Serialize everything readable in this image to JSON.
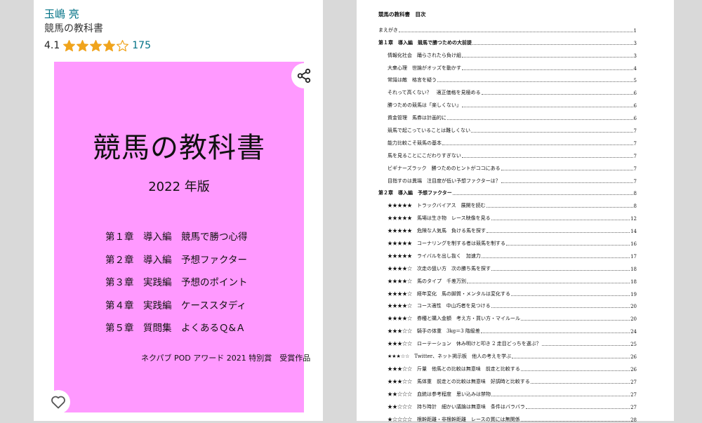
{
  "book": {
    "author": "玉嶋 亮",
    "title": "競馬の教科書",
    "rating": "4.1",
    "rating_stars": 4.1,
    "rating_count": "175"
  },
  "cover": {
    "title": "競馬の教科書",
    "edition": "2022 年版",
    "chapters": [
      "第１章　導入編　競馬で勝つ心得",
      "第２章　導入編　予想ファクター",
      "第３章　実践編　予想のポイント",
      "第４章　実践編　ケーススタディ",
      "第５章　質問集　よくあるＱ&Ａ"
    ],
    "award": "ネクパブ POD アワード 2021 特別賞　受賞作品",
    "background_color": "#ff99ff"
  },
  "icons": {
    "share": "share-icon",
    "favorite": "heart-icon",
    "star": "star-icon"
  },
  "colors": {
    "link": "#007185",
    "star": "#f0a41c"
  },
  "toc": {
    "heading": "競馬の教科書　目次",
    "entries": [
      {
        "text": "まえがき",
        "page": "1",
        "level": 0,
        "bold": false
      },
      {
        "text": "第１章　導入編　競馬で勝つための大前提",
        "page": "3",
        "level": 0,
        "bold": true
      },
      {
        "text": "情報化社会　踊らされたら負け組",
        "page": "3",
        "level": 1,
        "bold": false
      },
      {
        "text": "大衆心理　世論がオッズを動かす",
        "page": "4",
        "level": 1,
        "bold": false
      },
      {
        "text": "常識は敵　格言を疑う",
        "page": "5",
        "level": 1,
        "bold": false
      },
      {
        "text": "それって高くない？　適正価格を見極める",
        "page": "6",
        "level": 1,
        "bold": false
      },
      {
        "text": "勝つための競馬は「楽しくない」",
        "page": "6",
        "level": 1,
        "bold": false
      },
      {
        "text": "資金管理　馬券は計画的に",
        "page": "6",
        "level": 1,
        "bold": false
      },
      {
        "text": "競馬で起こっていることは難しくない",
        "page": "7",
        "level": 1,
        "bold": false
      },
      {
        "text": "能力比較こそ競馬の基本",
        "page": "7",
        "level": 1,
        "bold": false
      },
      {
        "text": "馬を見ることにこだわりすぎない",
        "page": "7",
        "level": 1,
        "bold": false
      },
      {
        "text": "ビギナーズラック　勝つためのヒントがココにある",
        "page": "7",
        "level": 1,
        "bold": false
      },
      {
        "text": "目指すのは異端　注目度が低い予想ファクターは？",
        "page": "7",
        "level": 1,
        "bold": false
      },
      {
        "text": "第２章　導入編　予想ファクター",
        "page": "8",
        "level": 0,
        "bold": true
      },
      {
        "text": "★★★★★　トラックバイアス　展開を読む",
        "page": "8",
        "level": 1,
        "bold": false
      },
      {
        "text": "★★★★★　馬場は生き物　レース映像を見る",
        "page": "12",
        "level": 1,
        "bold": false
      },
      {
        "text": "★★★★★　危険な人気馬　負ける馬を探す",
        "page": "14",
        "level": 1,
        "bold": false
      },
      {
        "text": "★★★★★　コーナリングを制する者は競馬を制する",
        "page": "16",
        "level": 1,
        "bold": false
      },
      {
        "text": "★★★★★　ライバルを出し抜く　加速力",
        "page": "17",
        "level": 1,
        "bold": false
      },
      {
        "text": "★★★★☆　次走の狙い方　次の勝ち馬を探す",
        "page": "18",
        "level": 1,
        "bold": false
      },
      {
        "text": "★★★★☆　馬のタイプ　千差万別",
        "page": "18",
        "level": 1,
        "bold": false
      },
      {
        "text": "★★★★☆　経年変化　馬の脚質・メンタルは変化する",
        "page": "19",
        "level": 1,
        "bold": false
      },
      {
        "text": "★★★★☆　コース適性　中山巧者を見つける",
        "page": "20",
        "level": 1,
        "bold": false
      },
      {
        "text": "★★★★☆　券種と購入金額　考え方・買い方・マイルール",
        "page": "20",
        "level": 1,
        "bold": false
      },
      {
        "text": "★★★☆☆　騎手の体重　3kg＝3 階級差",
        "page": "24",
        "level": 1,
        "bold": false
      },
      {
        "text": "★★★☆☆　ローテーション　休み明けと叩き 2 走目どっちを選ぶ？",
        "page": "25",
        "level": 1,
        "bold": false
      },
      {
        "text": "★★★☆☆　Twitter、ネット掲示板　他人の考えを学ぶ",
        "page": "26",
        "level": 1,
        "bold": false
      },
      {
        "text": "★★★☆☆　斤量　他馬との比較は無意味　前走と比較する",
        "page": "26",
        "level": 1,
        "bold": false
      },
      {
        "text": "★★★☆☆　馬体重　前走との比較は無意味　好調時と比較する",
        "page": "27",
        "level": 1,
        "bold": false
      },
      {
        "text": "★★☆☆☆　血統は参考程度　思い込みは禁物",
        "page": "27",
        "level": 1,
        "bold": false
      },
      {
        "text": "★★☆☆☆　持ち時計　細かい議論は無意味　条件はバラバラ",
        "page": "27",
        "level": 1,
        "bold": false
      },
      {
        "text": "★☆☆☆☆　根幹距離・非根幹距離　レースの質には無関係",
        "page": "28",
        "level": 1,
        "bold": false
      }
    ]
  }
}
